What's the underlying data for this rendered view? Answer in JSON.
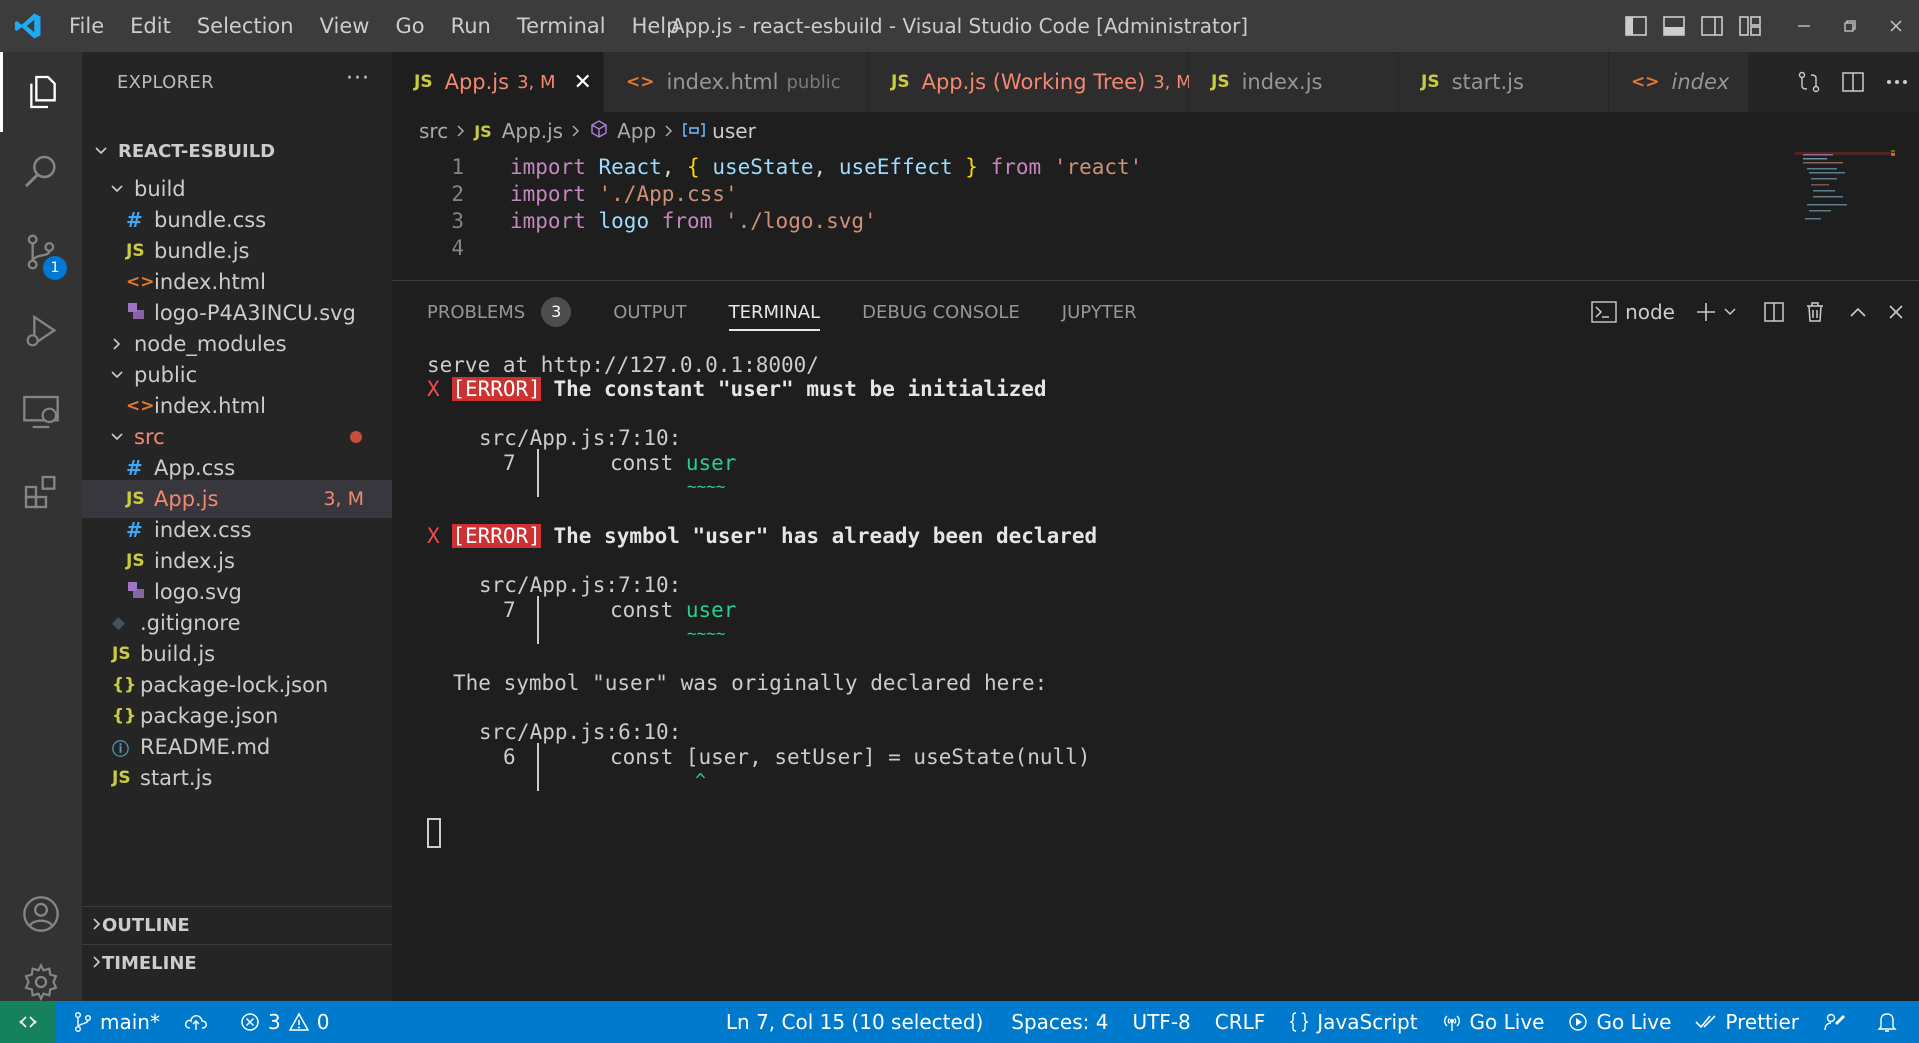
{
  "window": {
    "title": "App.js - react-esbuild - Visual Studio Code [Administrator]",
    "menu": [
      "File",
      "Edit",
      "Selection",
      "View",
      "Go",
      "Run",
      "Terminal",
      "Help"
    ]
  },
  "activity": {
    "scm_badge": "1"
  },
  "sidebar": {
    "title": "EXPLORER",
    "more": "···",
    "root": "REACT-ESBUILD",
    "items": [
      {
        "label": "build",
        "type": "folder",
        "open": true
      },
      {
        "label": "bundle.css",
        "icon": "#"
      },
      {
        "label": "bundle.js",
        "icon": "JS"
      },
      {
        "label": "index.html",
        "icon": "<>"
      },
      {
        "label": "logo-P4A3INCU.svg",
        "icon": "svg"
      },
      {
        "label": "node_modules",
        "type": "folder",
        "open": false
      },
      {
        "label": "public",
        "type": "folder",
        "open": true
      },
      {
        "label": "index.html",
        "icon": "<>"
      },
      {
        "label": "src",
        "type": "folder",
        "open": true
      },
      {
        "label": "App.css",
        "icon": "#"
      },
      {
        "label": "App.js",
        "icon": "JS",
        "status": "3, M"
      },
      {
        "label": "index.css",
        "icon": "#"
      },
      {
        "label": "index.js",
        "icon": "JS"
      },
      {
        "label": "logo.svg",
        "icon": "svg"
      },
      {
        "label": ".gitignore",
        "icon": "◆"
      },
      {
        "label": "build.js",
        "icon": "JS"
      },
      {
        "label": "package-lock.json",
        "icon": "{}"
      },
      {
        "label": "package.json",
        "icon": "{}"
      },
      {
        "label": "README.md",
        "icon": "ⓘ"
      },
      {
        "label": "start.js",
        "icon": "JS"
      }
    ],
    "outline": "OUTLINE",
    "timeline": "TIMELINE"
  },
  "tabs": [
    {
      "icon": "JS",
      "label": "App.js",
      "desc": "3, M",
      "close": "✕"
    },
    {
      "icon": "<>",
      "label": "index.html",
      "desc": "public"
    },
    {
      "icon": "JS",
      "label": "App.js (Working Tree)",
      "desc": "3, M"
    },
    {
      "icon": "JS",
      "label": "index.js"
    },
    {
      "icon": "JS",
      "label": "start.js"
    },
    {
      "icon": "<>",
      "label": "index"
    }
  ],
  "breadcrumb": {
    "folder": "src",
    "file_icon": "JS",
    "file": "App.js",
    "component": "App",
    "symbol": "user"
  },
  "editor": {
    "line_numbers": [
      "1",
      "2",
      "3",
      "4"
    ],
    "l1": {
      "kw1": "import",
      "name": "React",
      "c1": ",",
      "b1": "{",
      "n2": "useState",
      "c2": ",",
      "n3": "useEffect",
      "b2": "}",
      "kw2": "from",
      "str": "'react'"
    },
    "l2": {
      "kw1": "import",
      "str": "'./App.css'"
    },
    "l3": {
      "kw1": "import",
      "name": "logo",
      "kw2": "from",
      "str": "'./logo.svg'"
    }
  },
  "panel": {
    "tabs": [
      "PROBLEMS",
      "OUTPUT",
      "TERMINAL",
      "DEBUG CONSOLE",
      "JUPYTER"
    ],
    "problems_count": "3",
    "active_tab": "TERMINAL",
    "terminal_name": "node"
  },
  "terminal": {
    "serve": "serve at http://127.0.0.1:8000/",
    "x": "X",
    "err_tag": "[ERROR]",
    "err1": "The constant \"user\" must be initialized",
    "loc1": "src/App.js:7:10:",
    "ln7": "7",
    "code7_pre": "const ",
    "code7_hl": "user",
    "squiggle": "~~~~",
    "err2": "The symbol \"user\" has already been declared",
    "loc2": "src/App.js:7:10:",
    "orig": "The symbol \"user\" was originally declared here:",
    "loc3": "src/App.js:6:10:",
    "ln6": "6",
    "code6": "const [user, setUser] = useState(null)",
    "caret": "^"
  },
  "status": {
    "branch": "main*",
    "errors": "3",
    "warnings": "0",
    "position": "Ln 7, Col 15 (10 selected)",
    "spaces": "Spaces: 4",
    "encoding": "UTF-8",
    "eol": "CRLF",
    "language": "JavaScript",
    "golive1": "Go Live",
    "golive2": "Go Live",
    "prettier": "Prettier"
  },
  "colors": {
    "statusbar": "#007acc",
    "remote": "#16825d",
    "error": "#cd3131",
    "modified": "#f48771"
  }
}
